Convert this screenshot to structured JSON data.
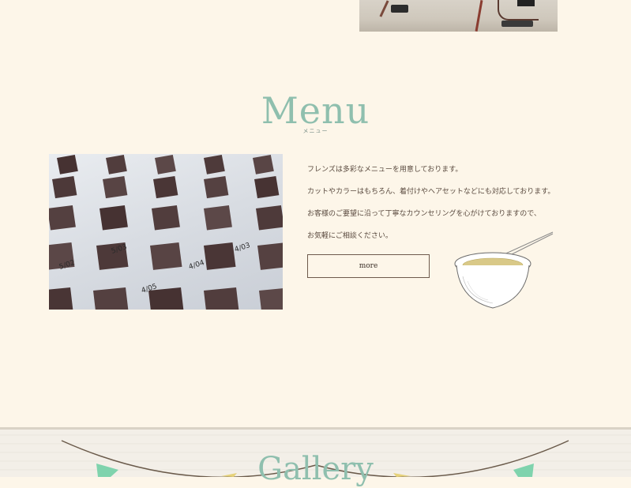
{
  "menu": {
    "title": "Menu",
    "subtitle": "メニュー",
    "lines": [
      "フレンズは多彩なメニューを用意しております。",
      "カットやカラーはもちろん、着付けやヘアセットなどにも対応しております。",
      "お客様のご要望に沿って丁寧なカウンセリングを心がけておりますので、",
      "お気軽にご相談ください。"
    ],
    "more_label": "more",
    "swatch_labels": [
      "5/02",
      "5/03",
      "4/04",
      "4/03",
      "4/05"
    ]
  },
  "gallery": {
    "title": "Gallery"
  },
  "colors": {
    "background": "#fdf6e9",
    "accent": "#8fbfae",
    "text": "#5a4a3f",
    "flag_green": "#7fd3ad"
  },
  "icons": [
    "hair-color-bowl-icon"
  ]
}
